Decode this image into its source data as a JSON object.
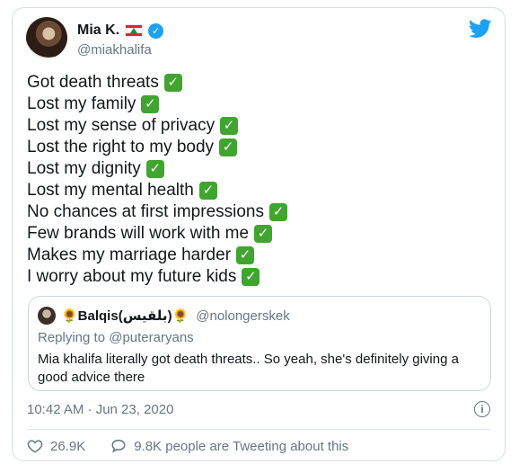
{
  "author": {
    "display_name": "Mia K.",
    "handle": "@miakhalifa",
    "verified": true
  },
  "tweet_lines": [
    "Got death threats",
    "Lost my family",
    "Lost my sense of privacy",
    "Lost the right to my body",
    "Lost my dignity",
    "Lost my mental health",
    "No chances at first impressions",
    "Few brands will work with me",
    "Makes my marriage harder",
    "I worry about my future kids"
  ],
  "check_glyph": "✓",
  "quoted_tweet": {
    "display_name": "🌻Balqis(بلقيس)🌻",
    "handle": "@nolongerskek",
    "replying_to_label": "Replying to",
    "replying_to_handle": "@puteraryans",
    "text": "Mia khalifa literally got death threats.. So yeah, she's definitely giving a good advice there"
  },
  "timestamp": "10:42 AM · Jun 23, 2020",
  "likes": "26.9K",
  "replies_text": "9.8K people are Tweeting about this",
  "colors": {
    "accent": "#1da1f2",
    "check_green": "#40a52f",
    "muted": "#657786"
  }
}
